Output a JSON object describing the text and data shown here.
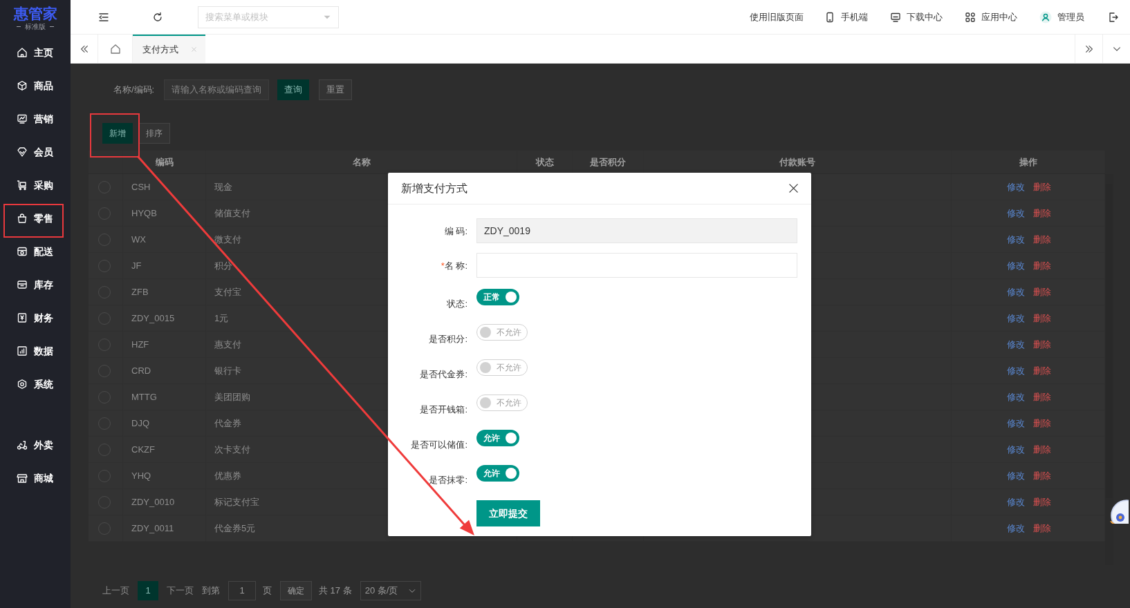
{
  "sidebar": {
    "logo": "惠管家",
    "edition": "标准版",
    "items": [
      {
        "label": "主页"
      },
      {
        "label": "商品"
      },
      {
        "label": "营销"
      },
      {
        "label": "会员"
      },
      {
        "label": "采购"
      },
      {
        "label": "零售"
      },
      {
        "label": "配送"
      },
      {
        "label": "库存"
      },
      {
        "label": "财务"
      },
      {
        "label": "数据"
      },
      {
        "label": "系统"
      }
    ],
    "extra_items": [
      {
        "label": "外卖"
      },
      {
        "label": "商城"
      }
    ]
  },
  "header": {
    "search": {
      "placeholder": "搜索菜单或模块"
    },
    "links": [
      {
        "label": "使用旧版页面"
      },
      {
        "label": "手机端"
      },
      {
        "label": "下载中心"
      },
      {
        "label": "应用中心"
      },
      {
        "label": "管理员"
      }
    ]
  },
  "tabs": [
    {
      "label": "支付方式",
      "selected": true
    }
  ],
  "filter": {
    "label": "名称/编码:",
    "placeholder": "请输入名称或编码查询",
    "buttons": [
      "查询",
      "重置"
    ]
  },
  "toolbar": [
    "新增",
    "排序"
  ],
  "table": {
    "columns": [
      "编码",
      "名称",
      "状态",
      "是否积分",
      "付款账号",
      "操作"
    ],
    "rows": [
      {
        "code": "CSH",
        "name": "现金",
        "selected": false,
        "actions": [
          "修改",
          "删除"
        ]
      },
      {
        "code": "HYQB",
        "name": "储值支付",
        "selected": false,
        "actions": [
          "修改",
          "删除"
        ]
      },
      {
        "code": "WX",
        "name": "微支付",
        "selected": false,
        "actions": [
          "修改",
          "删除"
        ]
      },
      {
        "code": "JF",
        "name": "积分",
        "selected": false,
        "actions": [
          "修改",
          "删除"
        ]
      },
      {
        "code": "ZFB",
        "name": "支付宝",
        "selected": false,
        "actions": [
          "修改",
          "删除"
        ]
      },
      {
        "code": "ZDY_0015",
        "name": "1元",
        "selected": false,
        "actions": [
          "修改",
          "删除"
        ]
      },
      {
        "code": "HZF",
        "name": "惠支付",
        "selected": false,
        "actions": [
          "修改",
          "删除"
        ]
      },
      {
        "code": "CRD",
        "name": "银行卡",
        "selected": false,
        "actions": [
          "修改",
          "删除"
        ]
      },
      {
        "code": "MTTG",
        "name": "美团团购",
        "selected": false,
        "actions": [
          "修改",
          "删除"
        ]
      },
      {
        "code": "DJQ",
        "name": "代金券",
        "selected": false,
        "actions": [
          "修改",
          "删除"
        ]
      },
      {
        "code": "CKZF",
        "name": "次卡支付",
        "selected": false,
        "actions": [
          "修改",
          "删除"
        ]
      },
      {
        "code": "YHQ",
        "name": "优惠券",
        "selected": false,
        "actions": [
          "修改",
          "删除"
        ]
      },
      {
        "code": "ZDY_0010",
        "name": "标记支付宝",
        "selected": false,
        "actions": [
          "修改",
          "删除"
        ]
      },
      {
        "code": "ZDY_0011",
        "name": "代金券5元",
        "selected": false,
        "actions": [
          "修改",
          "删除"
        ]
      }
    ]
  },
  "pagination": {
    "prev": "上一页",
    "page": "1",
    "next": "下一页",
    "goto": "到第",
    "page_input": "1",
    "page_unit": "页",
    "confirm": "确定",
    "total": "共 17 条",
    "page_size": "20 条/页"
  },
  "dialog": {
    "title": "新增支付方式",
    "fields": [
      {
        "kind": "text",
        "label": "编 码:",
        "value": "ZDY_0019",
        "readonly": true
      },
      {
        "kind": "text",
        "marker": "*",
        "label": "名 称:",
        "readonly": false
      },
      {
        "kind": "switch",
        "label": "状态:",
        "on": true,
        "text": "正常"
      },
      {
        "kind": "switch",
        "label": "是否积分:",
        "on": false,
        "text": "不允许"
      },
      {
        "kind": "switch",
        "label": "是否代金券:",
        "on": false,
        "text": "不允许"
      },
      {
        "kind": "switch",
        "label": "是否开钱箱:",
        "on": false,
        "text": "不允许"
      },
      {
        "kind": "switch",
        "label": "是否可以储值:",
        "on": true,
        "text": "允许"
      },
      {
        "kind": "switch",
        "label": "是否抹零:",
        "on": true,
        "text": "允许"
      }
    ],
    "submit": "立即提交"
  }
}
